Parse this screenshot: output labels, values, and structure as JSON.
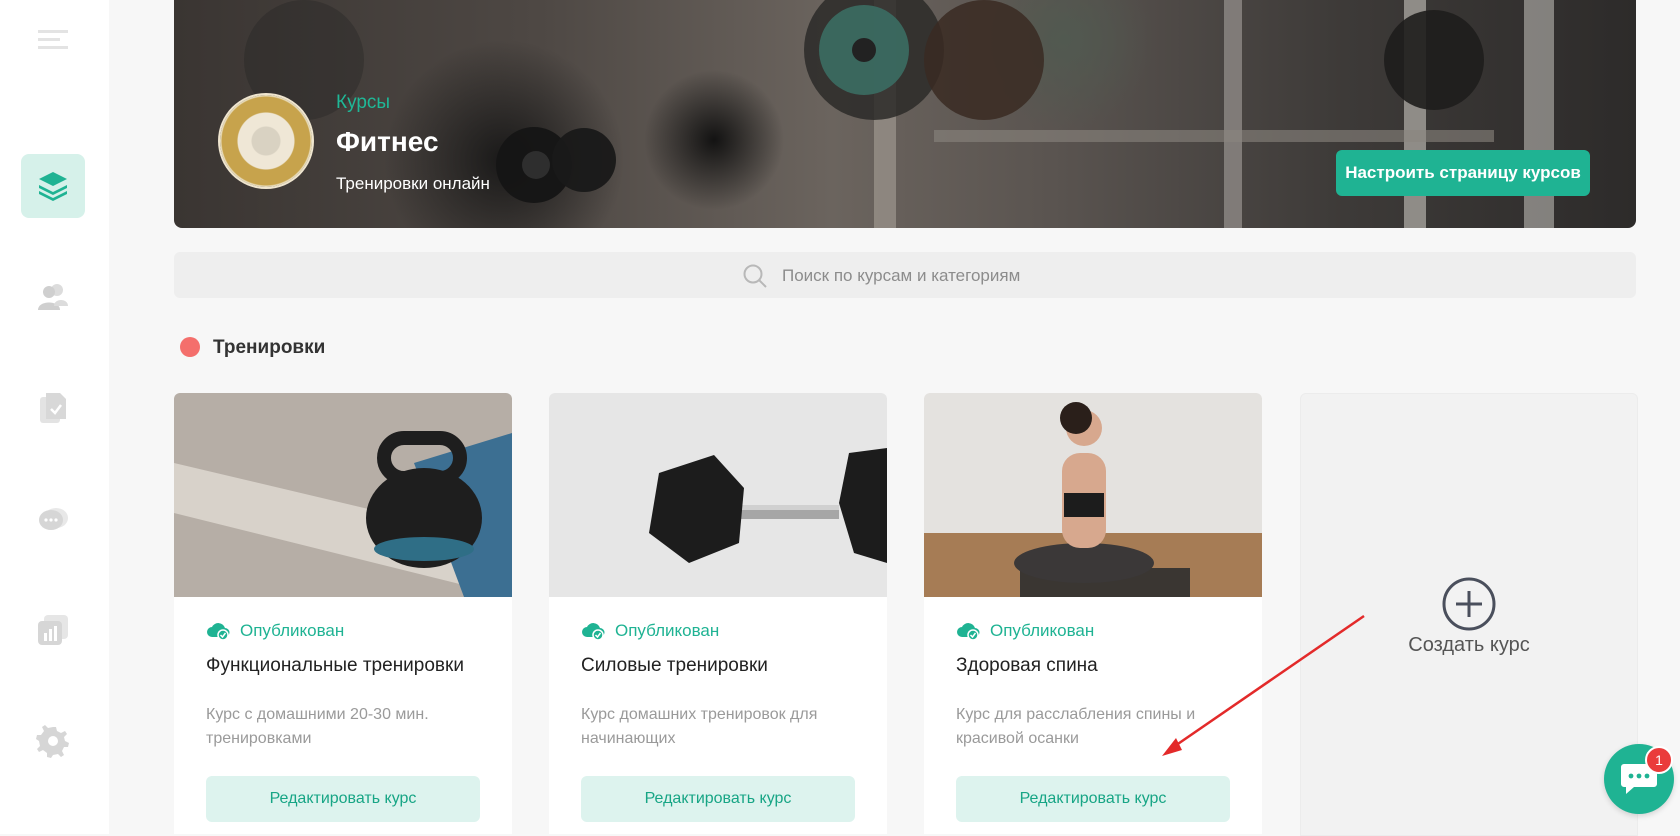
{
  "sidebar": {
    "items": [
      {
        "icon": "menu-icon"
      },
      {
        "icon": "layers-icon",
        "active": true
      },
      {
        "icon": "users-icon"
      },
      {
        "icon": "document-check-icon"
      },
      {
        "icon": "chat-icon"
      },
      {
        "icon": "chart-icon"
      },
      {
        "icon": "settings-icon"
      }
    ]
  },
  "hero": {
    "breadcrumb": "Курсы",
    "title": "Фитнес",
    "subtitle": "Тренировки онлайн",
    "button_label": "Настроить страницу курсов"
  },
  "search": {
    "placeholder": "Поиск по курсам и категориям"
  },
  "category": {
    "title": "Тренировки",
    "color": "#f46f6c"
  },
  "cards": [
    {
      "status": "Опубликован",
      "title": "Функциональные тренировки",
      "description": "Курс с домашними 20-30 мин. тренировками",
      "button": "Редактировать курс"
    },
    {
      "status": "Опубликован",
      "title": "Силовые тренировки",
      "description": "Курс домашних тренировок для начинающих",
      "button": "Редактировать курс"
    },
    {
      "status": "Опубликован",
      "title": "Здоровая спина",
      "description": "Курс для расслабления спины и красивой осанки",
      "button": "Редактировать курс"
    }
  ],
  "create_card": {
    "label": "Создать курс"
  },
  "chat": {
    "badge": "1"
  },
  "colors": {
    "accent": "#1fb393",
    "accent_light": "#ddf3ee",
    "category_dot": "#f46f6c",
    "badge": "#ea3b3b"
  }
}
